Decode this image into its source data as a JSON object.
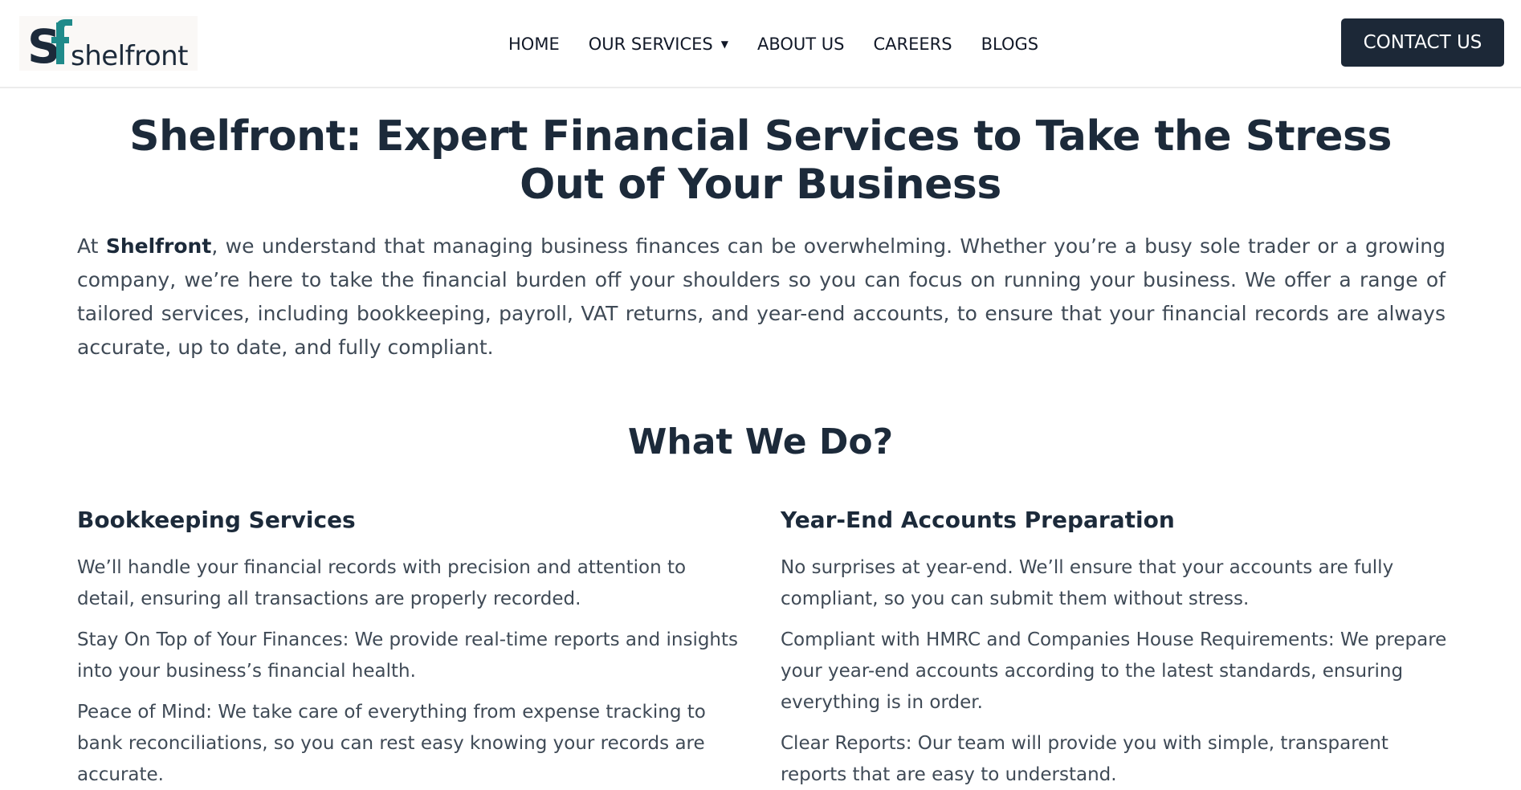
{
  "header": {
    "logo_text": "shelfront",
    "nav": [
      {
        "label": "HOME"
      },
      {
        "label": "OUR SERVICES",
        "has_dropdown": true
      },
      {
        "label": "ABOUT US"
      },
      {
        "label": "CAREERS"
      },
      {
        "label": "BLOGS"
      }
    ],
    "contact_label": "CONTACT US"
  },
  "hero": {
    "title_line1": "Shelfront: Expert Financial Services to Take the Stress",
    "title_line2": "Out of Your Business",
    "intro_prefix": "At ",
    "intro_brand": "Shelfront",
    "intro_rest": ", we understand that managing business finances can be overwhelming. Whether you’re a busy sole trader or a growing company, we’re here to take the financial burden off your shoulders so you can focus on running your business. We offer a range of tailored services, including bookkeeping, payroll, VAT returns, and year-end accounts, to ensure that your financial records are always accurate, up to date, and fully compliant."
  },
  "services": {
    "title": "What We Do?",
    "left": {
      "heading": "Bookkeeping Services",
      "paragraphs": [
        "We’ll handle your financial records with precision and attention to detail, ensuring all transactions are properly recorded.",
        "Stay On Top of Your Finances: We provide real-time reports and insights into your business’s financial health.",
        "Peace of Mind: We take care of everything from expense tracking to bank reconciliations, so you can rest easy knowing your records are accurate."
      ]
    },
    "right": {
      "heading": "Year-End Accounts Preparation",
      "paragraphs": [
        "No surprises at year-end. We’ll ensure that your accounts are fully compliant, so you can submit them without stress.",
        "Compliant with HMRC and Companies House Requirements: We prepare your year-end accounts according to the latest standards, ensuring everything is in order.",
        "Clear Reports: Our team will provide you with simple, transparent reports that are easy to understand."
      ]
    }
  },
  "colors": {
    "brand_dark": "#1c2837",
    "brand_teal": "#1f8a8a",
    "text": "#3f4a56"
  },
  "icons": {
    "logo": "shelfront-sf-logo",
    "dropdown": "caret-down-icon"
  }
}
